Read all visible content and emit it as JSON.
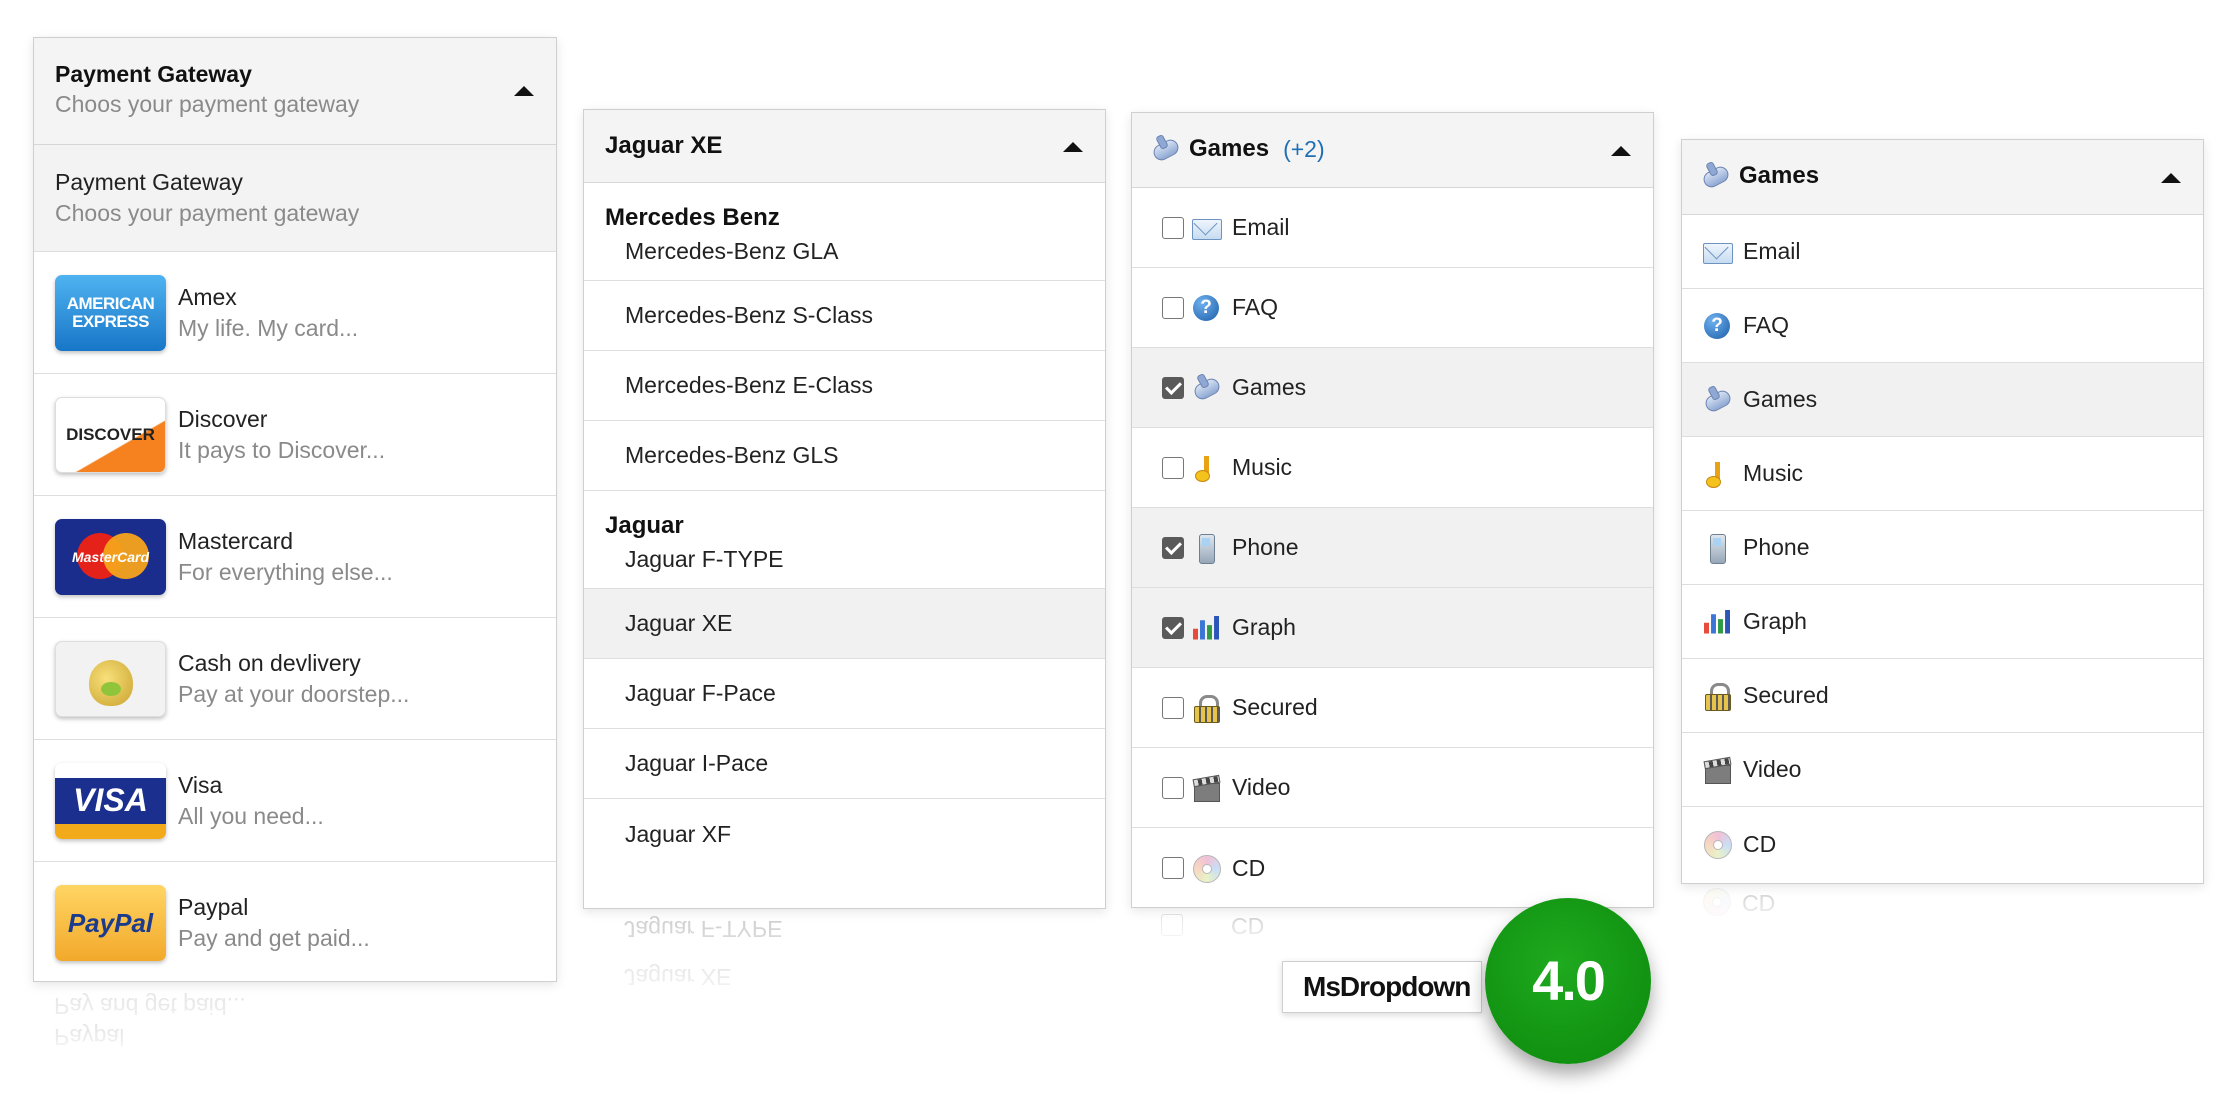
{
  "payment": {
    "header_title": "Payment Gateway",
    "header_subtitle": "Choos your payment gateway",
    "default_title": "Payment Gateway",
    "default_subtitle": "Choos your payment gateway",
    "options": [
      {
        "name": "Amex",
        "desc": "My life. My card...",
        "icon": "amex-card-icon",
        "icon_text": "AMERICAN EXPRESS"
      },
      {
        "name": "Discover",
        "desc": "It pays to Discover...",
        "icon": "discover-card-icon",
        "icon_text": "DISCOVER"
      },
      {
        "name": "Mastercard",
        "desc": "For everything else...",
        "icon": "mastercard-card-icon",
        "icon_text": "MasterCard"
      },
      {
        "name": "Cash on devlivery",
        "desc": "Pay at your doorstep...",
        "icon": "money-bag-icon",
        "icon_text": ""
      },
      {
        "name": "Visa",
        "desc": "All you need...",
        "icon": "visa-card-icon",
        "icon_text": "VISA"
      },
      {
        "name": "Paypal",
        "desc": "Pay and get paid...",
        "icon": "paypal-card-icon",
        "icon_text": "PayPal"
      }
    ]
  },
  "cars": {
    "selected": "Jaguar XE",
    "groups": [
      {
        "label": "Mercedes Benz",
        "options": [
          "Mercedes-Benz GLA",
          "Mercedes-Benz S-Class",
          "Mercedes-Benz E-Class",
          "Mercedes-Benz GLS"
        ]
      },
      {
        "label": "Jaguar",
        "options": [
          "Jaguar F-TYPE",
          "Jaguar XE",
          "Jaguar F-Pace",
          "Jaguar I-Pace",
          "Jaguar XF"
        ]
      }
    ],
    "reflection_text": "Jaguar XE"
  },
  "games_multi": {
    "header_label": "Games",
    "header_count": "(+2)",
    "header_icon": "gamepad-icon",
    "items": [
      {
        "label": "Email",
        "icon": "mail-icon",
        "checked": false
      },
      {
        "label": "FAQ",
        "icon": "help-icon",
        "checked": false
      },
      {
        "label": "Games",
        "icon": "gamepad-icon",
        "checked": true
      },
      {
        "label": "Music",
        "icon": "music-note-icon",
        "checked": false
      },
      {
        "label": "Phone",
        "icon": "phone-icon",
        "checked": true
      },
      {
        "label": "Graph",
        "icon": "bar-chart-icon",
        "checked": true
      },
      {
        "label": "Secured",
        "icon": "lock-icon",
        "checked": false
      },
      {
        "label": "Video",
        "icon": "clapperboard-icon",
        "checked": false
      },
      {
        "label": "CD",
        "icon": "cd-icon",
        "checked": false
      }
    ],
    "reflection_text": "CD"
  },
  "games_single": {
    "header_label": "Games",
    "header_icon": "gamepad-icon",
    "selected": "Games",
    "items": [
      {
        "label": "Email",
        "icon": "mail-icon"
      },
      {
        "label": "FAQ",
        "icon": "help-icon"
      },
      {
        "label": "Games",
        "icon": "gamepad-icon"
      },
      {
        "label": "Music",
        "icon": "music-note-icon"
      },
      {
        "label": "Phone",
        "icon": "phone-icon"
      },
      {
        "label": "Graph",
        "icon": "bar-chart-icon"
      },
      {
        "label": "Secured",
        "icon": "lock-icon"
      },
      {
        "label": "Video",
        "icon": "clapperboard-icon"
      },
      {
        "label": "CD",
        "icon": "cd-icon"
      }
    ],
    "reflection_text": "CD"
  },
  "badge": {
    "label": "MsDropdown",
    "version": "4.0",
    "color": "#149a14"
  }
}
